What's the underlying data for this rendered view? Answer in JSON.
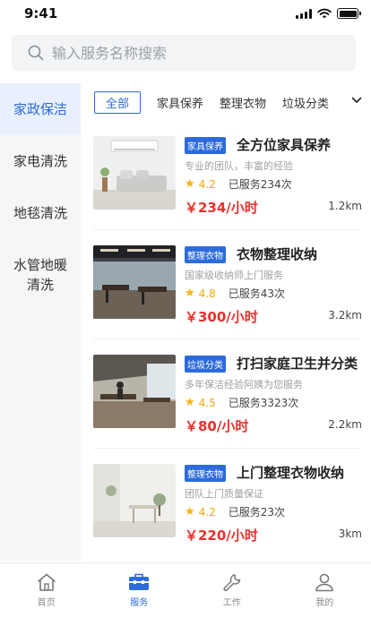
{
  "status_bar": {
    "time": "9:41"
  },
  "search": {
    "placeholder": "输入服务名称搜索"
  },
  "sidebar": {
    "items": [
      {
        "label": "家政保洁"
      },
      {
        "label": "家电清洗"
      },
      {
        "label": "地毯清洗"
      },
      {
        "label": "水管地暖清洗"
      }
    ]
  },
  "tabs": {
    "items": [
      {
        "label": "全部"
      },
      {
        "label": "家具保养"
      },
      {
        "label": "整理衣物"
      },
      {
        "label": "垃圾分类"
      }
    ]
  },
  "services": [
    {
      "tag": "家具保养",
      "title": "全方位家具保养",
      "desc": "专业的团队，丰富的经验",
      "rating": "4.2",
      "served": "已服务234次",
      "price": "￥234/小时",
      "distance": "1.2km"
    },
    {
      "tag": "整理衣物",
      "title": "衣物整理收纳",
      "desc": "国家级收纳师上门服务",
      "rating": "4.8",
      "served": "已服务43次",
      "price": "￥300/小时",
      "distance": "3.2km"
    },
    {
      "tag": "垃圾分类",
      "title": "打扫家庭卫生并分类",
      "desc": "多年保洁经验阿姨为您服务",
      "rating": "4.5",
      "served": "已服务3323次",
      "price": "￥80/小时",
      "distance": "2.2km"
    },
    {
      "tag": "整理衣物",
      "title": "上门整理衣物收纳",
      "desc": "团队上门质量保证",
      "rating": "4.2",
      "served": "已服务23次",
      "price": "￥220/小时",
      "distance": "3km"
    }
  ],
  "bottom_nav": {
    "items": [
      {
        "label": "首页",
        "icon": "home-icon"
      },
      {
        "label": "服务",
        "icon": "toolbox-icon"
      },
      {
        "label": "工作",
        "icon": "wrench-icon"
      },
      {
        "label": "我的",
        "icon": "user-icon"
      }
    ]
  },
  "colors": {
    "accent": "#2d6bdc",
    "price": "#e5322d",
    "star": "#f6b40e"
  }
}
